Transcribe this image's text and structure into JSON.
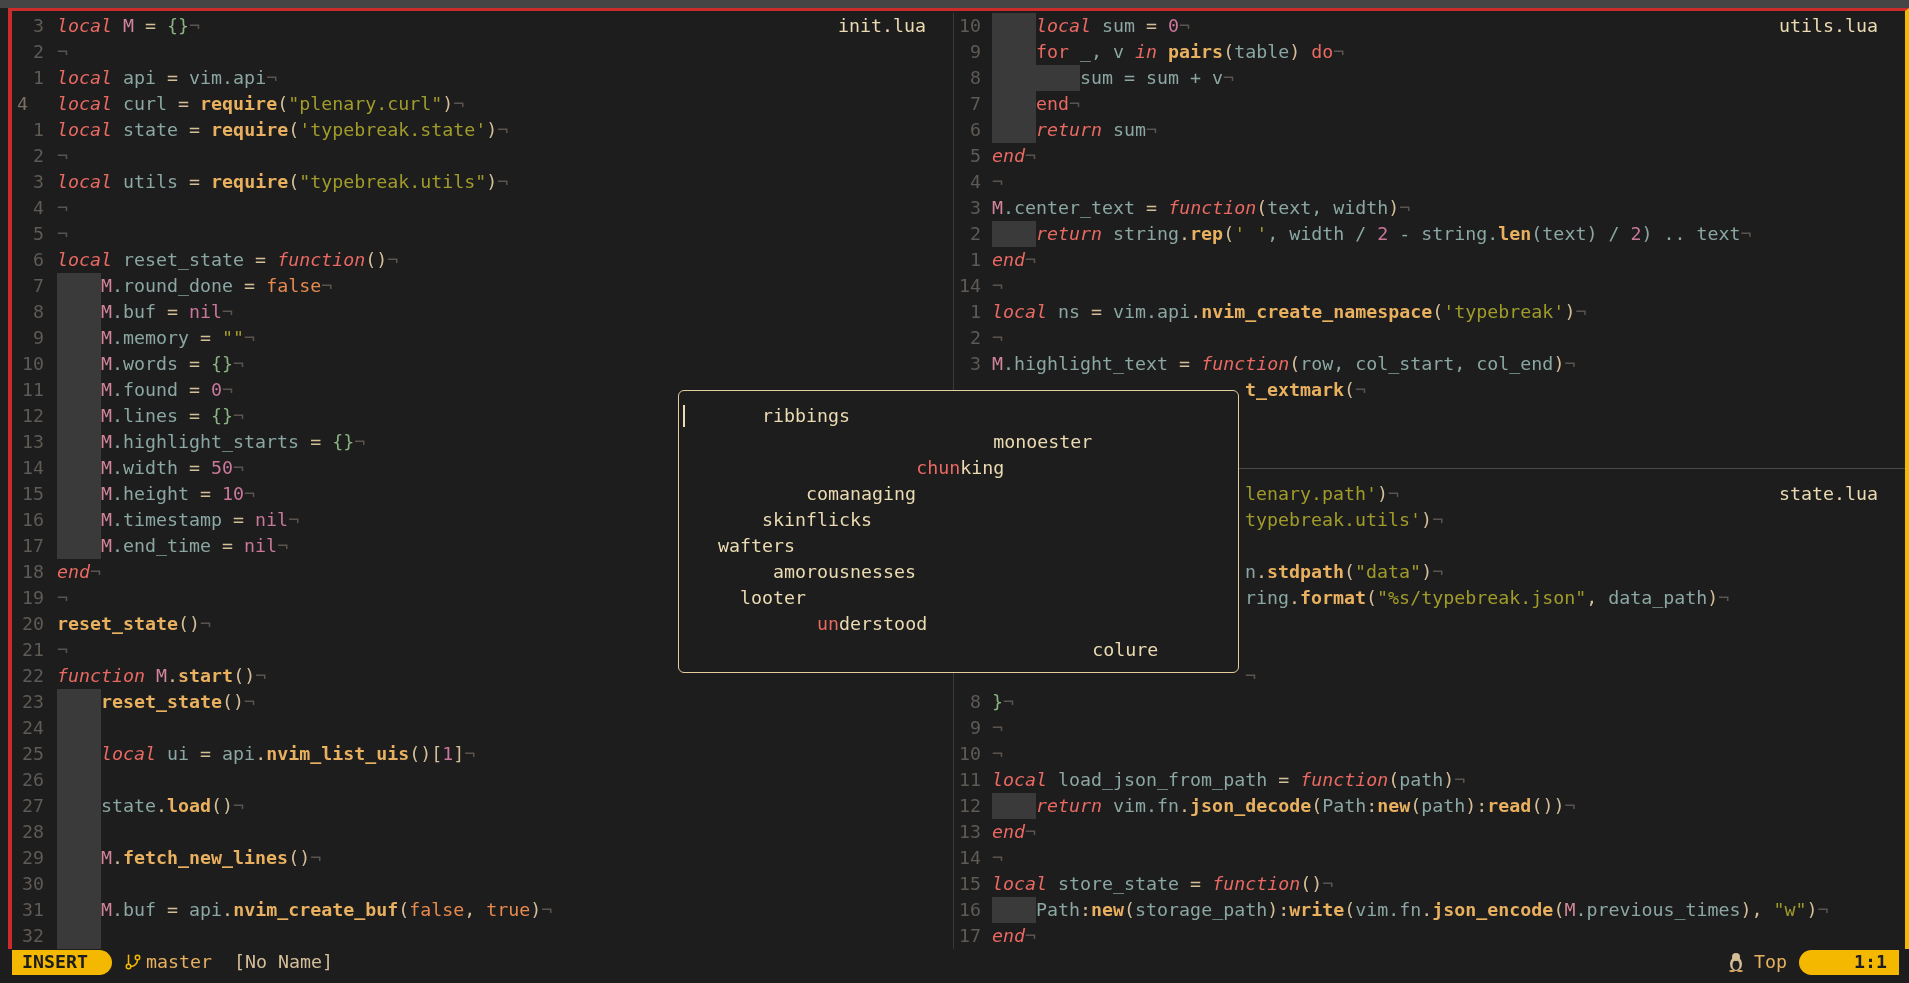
{
  "panes": [
    {
      "title": "init.lua",
      "rows": [
        {
          "kind": "code",
          "number": "3",
          "current": false,
          "tokens": [
            {
              "text": "local",
              "kind": "kw"
            },
            {
              "text": " M",
              "kind": "mod"
            },
            {
              "text": " = ",
              "kind": "op"
            },
            {
              "text": "{}",
              "kind": "tbl"
            },
            {
              "text": "¬",
              "kind": "eol"
            }
          ]
        },
        {
          "kind": "code",
          "number": "2",
          "current": false,
          "tokens": [
            {
              "text": "¬",
              "kind": "eol"
            }
          ]
        },
        {
          "kind": "code",
          "number": "1",
          "current": false,
          "tokens": [
            {
              "text": "local",
              "kind": "kw"
            },
            {
              "text": " api",
              "kind": "id"
            },
            {
              "text": " = ",
              "kind": "op"
            },
            {
              "text": "vim.api",
              "kind": "id"
            },
            {
              "text": "¬",
              "kind": "eol"
            }
          ]
        },
        {
          "kind": "code",
          "number": "4",
          "current": true,
          "tokens": [
            {
              "text": "local",
              "kind": "kw"
            },
            {
              "text": " curl",
              "kind": "id"
            },
            {
              "text": " = ",
              "kind": "op"
            },
            {
              "text": "require",
              "kind": "fn"
            },
            {
              "text": "(",
              "kind": "op"
            },
            {
              "text": "\"plenary.curl\"",
              "kind": "str"
            },
            {
              "text": ")",
              "kind": "op"
            },
            {
              "text": "¬",
              "kind": "eol"
            }
          ]
        },
        {
          "kind": "code",
          "number": "1",
          "current": false,
          "tokens": [
            {
              "text": "local",
              "kind": "kw"
            },
            {
              "text": " state",
              "kind": "id"
            },
            {
              "text": " = ",
              "kind": "op"
            },
            {
              "text": "require",
              "kind": "fn"
            },
            {
              "text": "(",
              "kind": "op"
            },
            {
              "text": "'typebreak.state'",
              "kind": "str"
            },
            {
              "text": ")",
              "kind": "op"
            },
            {
              "text": "¬",
              "kind": "eol"
            }
          ]
        },
        {
          "kind": "code",
          "number": "2",
          "current": false,
          "tokens": [
            {
              "text": "¬",
              "kind": "eol"
            }
          ]
        },
        {
          "kind": "code",
          "number": "3",
          "current": false,
          "tokens": [
            {
              "text": "local",
              "kind": "kw"
            },
            {
              "text": " utils",
              "kind": "id"
            },
            {
              "text": " = ",
              "kind": "op"
            },
            {
              "text": "require",
              "kind": "fn"
            },
            {
              "text": "(",
              "kind": "op"
            },
            {
              "text": "\"typebreak.utils\"",
              "kind": "str"
            },
            {
              "text": ")",
              "kind": "op"
            },
            {
              "text": "¬",
              "kind": "eol"
            }
          ]
        },
        {
          "kind": "code",
          "number": "4",
          "current": false,
          "tokens": [
            {
              "text": "¬",
              "kind": "eol"
            }
          ]
        },
        {
          "kind": "code",
          "number": "5",
          "current": false,
          "tokens": [
            {
              "text": "¬",
              "kind": "eol"
            }
          ]
        },
        {
          "kind": "code",
          "number": "6",
          "current": false,
          "tokens": [
            {
              "text": "local",
              "kind": "kw"
            },
            {
              "text": " reset_state",
              "kind": "id"
            },
            {
              "text": " = ",
              "kind": "op"
            },
            {
              "text": "function",
              "kind": "kw"
            },
            {
              "text": "()",
              "kind": "op"
            },
            {
              "text": "¬",
              "kind": "eol"
            }
          ]
        },
        {
          "kind": "code",
          "number": "7",
          "current": false,
          "indent": [
            {
              "shaded": true
            }
          ],
          "tokens": [
            {
              "text": "M",
              "kind": "mod"
            },
            {
              "text": ".round_done",
              "kind": "id"
            },
            {
              "text": " = ",
              "kind": "op"
            },
            {
              "text": "false",
              "kind": "bool"
            },
            {
              "text": "¬",
              "kind": "eol"
            }
          ]
        },
        {
          "kind": "code",
          "number": "8",
          "current": false,
          "indent": [
            {
              "shaded": true
            }
          ],
          "tokens": [
            {
              "text": "M",
              "kind": "mod"
            },
            {
              "text": ".buf",
              "kind": "id"
            },
            {
              "text": " = ",
              "kind": "op"
            },
            {
              "text": "nil",
              "kind": "num"
            },
            {
              "text": "¬",
              "kind": "eol"
            }
          ]
        },
        {
          "kind": "code",
          "number": "9",
          "current": false,
          "indent": [
            {
              "shaded": true
            }
          ],
          "tokens": [
            {
              "text": "M",
              "kind": "mod"
            },
            {
              "text": ".memory",
              "kind": "id"
            },
            {
              "text": " = ",
              "kind": "op"
            },
            {
              "text": "\"\"",
              "kind": "str"
            },
            {
              "text": "¬",
              "kind": "eol"
            }
          ]
        },
        {
          "kind": "code",
          "number": "10",
          "current": false,
          "indent": [
            {
              "shaded": true
            }
          ],
          "tokens": [
            {
              "text": "M",
              "kind": "mod"
            },
            {
              "text": ".words",
              "kind": "id"
            },
            {
              "text": " = ",
              "kind": "op"
            },
            {
              "text": "{}",
              "kind": "tbl"
            },
            {
              "text": "¬",
              "kind": "eol"
            }
          ]
        },
        {
          "kind": "code",
          "number": "11",
          "current": false,
          "indent": [
            {
              "shaded": true
            }
          ],
          "tokens": [
            {
              "text": "M",
              "kind": "mod"
            },
            {
              "text": ".found",
              "kind": "id"
            },
            {
              "text": " = ",
              "kind": "op"
            },
            {
              "text": "0",
              "kind": "num"
            },
            {
              "text": "¬",
              "kind": "eol"
            }
          ]
        },
        {
          "kind": "code",
          "number": "12",
          "current": false,
          "indent": [
            {
              "shaded": true
            }
          ],
          "tokens": [
            {
              "text": "M",
              "kind": "mod"
            },
            {
              "text": ".lines",
              "kind": "id"
            },
            {
              "text": " = ",
              "kind": "op"
            },
            {
              "text": "{}",
              "kind": "tbl"
            },
            {
              "text": "¬",
              "kind": "eol"
            }
          ]
        },
        {
          "kind": "code",
          "number": "13",
          "current": false,
          "indent": [
            {
              "shaded": true
            }
          ],
          "tokens": [
            {
              "text": "M",
              "kind": "mod"
            },
            {
              "text": ".highlight_starts",
              "kind": "id"
            },
            {
              "text": " = ",
              "kind": "op"
            },
            {
              "text": "{}",
              "kind": "tbl"
            },
            {
              "text": "¬",
              "kind": "eol"
            }
          ]
        },
        {
          "kind": "code",
          "number": "14",
          "current": false,
          "indent": [
            {
              "shaded": true
            }
          ],
          "tokens": [
            {
              "text": "M",
              "kind": "mod"
            },
            {
              "text": ".width",
              "kind": "id"
            },
            {
              "text": " = ",
              "kind": "op"
            },
            {
              "text": "50",
              "kind": "num"
            },
            {
              "text": "¬",
              "kind": "eol"
            }
          ]
        },
        {
          "kind": "code",
          "number": "15",
          "current": false,
          "indent": [
            {
              "shaded": true
            }
          ],
          "tokens": [
            {
              "text": "M",
              "kind": "mod"
            },
            {
              "text": ".height",
              "kind": "id"
            },
            {
              "text": " = ",
              "kind": "op"
            },
            {
              "text": "10",
              "kind": "num"
            },
            {
              "text": "¬",
              "kind": "eol"
            }
          ]
        },
        {
          "kind": "code",
          "number": "16",
          "current": false,
          "indent": [
            {
              "shaded": true
            }
          ],
          "tokens": [
            {
              "text": "M",
              "kind": "mod"
            },
            {
              "text": ".timestamp",
              "kind": "id"
            },
            {
              "text": " = ",
              "kind": "op"
            },
            {
              "text": "nil",
              "kind": "num"
            },
            {
              "text": "¬",
              "kind": "eol"
            }
          ]
        },
        {
          "kind": "code",
          "number": "17",
          "current": false,
          "indent": [
            {
              "shaded": true
            }
          ],
          "tokens": [
            {
              "text": "M",
              "kind": "mod"
            },
            {
              "text": ".end_time",
              "kind": "id"
            },
            {
              "text": " = ",
              "kind": "op"
            },
            {
              "text": "nil",
              "kind": "num"
            },
            {
              "text": "¬",
              "kind": "eol"
            }
          ]
        },
        {
          "kind": "code",
          "number": "18",
          "current": false,
          "tokens": [
            {
              "text": "end",
              "kind": "kw"
            },
            {
              "text": "¬",
              "kind": "eol"
            }
          ]
        },
        {
          "kind": "code",
          "number": "19",
          "current": false,
          "tokens": [
            {
              "text": "¬",
              "kind": "eol"
            }
          ]
        },
        {
          "kind": "code",
          "number": "20",
          "current": false,
          "tokens": [
            {
              "text": "reset_state",
              "kind": "fn"
            },
            {
              "text": "()",
              "kind": "op"
            },
            {
              "text": "¬",
              "kind": "eol"
            }
          ]
        },
        {
          "kind": "code",
          "number": "21",
          "current": false,
          "tokens": [
            {
              "text": "¬",
              "kind": "eol"
            }
          ]
        },
        {
          "kind": "code",
          "number": "22",
          "current": false,
          "tokens": [
            {
              "text": "function",
              "kind": "kw"
            },
            {
              "text": " M",
              "kind": "mod"
            },
            {
              "text": ".",
              "kind": "op"
            },
            {
              "text": "start",
              "kind": "fn"
            },
            {
              "text": "()",
              "kind": "op"
            },
            {
              "text": "¬",
              "kind": "eol"
            }
          ]
        },
        {
          "kind": "code",
          "number": "23",
          "current": false,
          "indent": [
            {
              "shaded": true
            }
          ],
          "tokens": [
            {
              "text": "reset_state",
              "kind": "fn"
            },
            {
              "text": "()",
              "kind": "op"
            },
            {
              "text": "¬",
              "kind": "eol"
            }
          ]
        },
        {
          "kind": "code",
          "number": "24",
          "current": false,
          "indent": [
            {
              "shaded": true
            }
          ]
        },
        {
          "kind": "code",
          "number": "25",
          "current": false,
          "indent": [
            {
              "shaded": true
            }
          ],
          "tokens": [
            {
              "text": "local",
              "kind": "kw"
            },
            {
              "text": " ui",
              "kind": "id"
            },
            {
              "text": " = ",
              "kind": "op"
            },
            {
              "text": "api",
              "kind": "id"
            },
            {
              "text": ".",
              "kind": "op"
            },
            {
              "text": "nvim_list_uis",
              "kind": "fn"
            },
            {
              "text": "()[",
              "kind": "op"
            },
            {
              "text": "1",
              "kind": "num"
            },
            {
              "text": "]",
              "kind": "op"
            },
            {
              "text": "¬",
              "kind": "eol"
            }
          ]
        },
        {
          "kind": "code",
          "number": "26",
          "current": false,
          "indent": [
            {
              "shaded": true
            }
          ]
        },
        {
          "kind": "code",
          "number": "27",
          "current": false,
          "indent": [
            {
              "shaded": true
            }
          ],
          "tokens": [
            {
              "text": "state",
              "kind": "id"
            },
            {
              "text": ".",
              "kind": "op"
            },
            {
              "text": "load",
              "kind": "fn"
            },
            {
              "text": "()",
              "kind": "op"
            },
            {
              "text": "¬",
              "kind": "eol"
            }
          ]
        },
        {
          "kind": "code",
          "number": "28",
          "current": false,
          "indent": [
            {
              "shaded": true
            }
          ]
        },
        {
          "kind": "code",
          "number": "29",
          "current": false,
          "indent": [
            {
              "shaded": true
            }
          ],
          "tokens": [
            {
              "text": "M",
              "kind": "mod"
            },
            {
              "text": ".",
              "kind": "op"
            },
            {
              "text": "fetch_new_lines",
              "kind": "fn"
            },
            {
              "text": "()",
              "kind": "op"
            },
            {
              "text": "¬",
              "kind": "eol"
            }
          ]
        },
        {
          "kind": "code",
          "number": "30",
          "current": false,
          "indent": [
            {
              "shaded": true
            }
          ]
        },
        {
          "kind": "code",
          "number": "31",
          "current": false,
          "indent": [
            {
              "shaded": true
            }
          ],
          "tokens": [
            {
              "text": "M",
              "kind": "mod"
            },
            {
              "text": ".buf",
              "kind": "id"
            },
            {
              "text": " = ",
              "kind": "op"
            },
            {
              "text": "api",
              "kind": "id"
            },
            {
              "text": ".",
              "kind": "op"
            },
            {
              "text": "nvim_create_buf",
              "kind": "fn"
            },
            {
              "text": "(",
              "kind": "op"
            },
            {
              "text": "false",
              "kind": "bool"
            },
            {
              "text": ", ",
              "kind": "op"
            },
            {
              "text": "true",
              "kind": "bool"
            },
            {
              "text": ")",
              "kind": "op"
            },
            {
              "text": "¬",
              "kind": "eol"
            }
          ]
        },
        {
          "kind": "code",
          "number": "32",
          "current": false,
          "indent": [
            {
              "shaded": true
            }
          ]
        }
      ]
    },
    {
      "title": "utils.lua",
      "rows": [
        {
          "kind": "code",
          "number": "10",
          "current": false,
          "indent": [
            {
              "shaded": true
            }
          ],
          "tokens": [
            {
              "text": "local",
              "kind": "kw"
            },
            {
              "text": " sum",
              "kind": "id"
            },
            {
              "text": " = ",
              "kind": "op"
            },
            {
              "text": "0",
              "kind": "num"
            },
            {
              "text": "¬",
              "kind": "eol"
            }
          ]
        },
        {
          "kind": "code",
          "number": "9",
          "current": false,
          "indent": [
            {
              "shaded": true
            }
          ],
          "tokens": [
            {
              "text": "for",
              "kind": "ctl"
            },
            {
              "text": " _, v ",
              "kind": "id"
            },
            {
              "text": "in",
              "kind": "kw"
            },
            {
              "text": " pairs",
              "kind": "fn"
            },
            {
              "text": "(",
              "kind": "op"
            },
            {
              "text": "table",
              "kind": "id"
            },
            {
              "text": ") ",
              "kind": "op"
            },
            {
              "text": "do",
              "kind": "ctl"
            },
            {
              "text": "¬",
              "kind": "eol"
            }
          ]
        },
        {
          "kind": "code",
          "number": "8",
          "current": false,
          "indent": [
            {
              "shaded": true
            },
            {
              "shaded": true
            }
          ],
          "tokens": [
            {
              "text": "sum = sum + v",
              "kind": "id"
            },
            {
              "text": "¬",
              "kind": "eol"
            }
          ]
        },
        {
          "kind": "code",
          "number": "7",
          "current": false,
          "indent": [
            {
              "shaded": true
            }
          ],
          "tokens": [
            {
              "text": "end",
              "kind": "ctl"
            },
            {
              "text": "¬",
              "kind": "eol"
            }
          ]
        },
        {
          "kind": "code",
          "number": "6",
          "current": false,
          "indent": [
            {
              "shaded": true
            }
          ],
          "tokens": [
            {
              "text": "return",
              "kind": "kw"
            },
            {
              "text": " sum",
              "kind": "id"
            },
            {
              "text": "¬",
              "kind": "eol"
            }
          ]
        },
        {
          "kind": "code",
          "number": "5",
          "current": false,
          "tokens": [
            {
              "text": "end",
              "kind": "kw"
            },
            {
              "text": "¬",
              "kind": "eol"
            }
          ]
        },
        {
          "kind": "code",
          "number": "4",
          "current": false,
          "tokens": [
            {
              "text": "¬",
              "kind": "eol"
            }
          ]
        },
        {
          "kind": "code",
          "number": "3",
          "current": false,
          "tokens": [
            {
              "text": "M",
              "kind": "mod"
            },
            {
              "text": ".center_text",
              "kind": "id"
            },
            {
              "text": " = ",
              "kind": "op"
            },
            {
              "text": "function",
              "kind": "kw"
            },
            {
              "text": "(",
              "kind": "op"
            },
            {
              "text": "text, width",
              "kind": "id"
            },
            {
              "text": ")",
              "kind": "op"
            },
            {
              "text": "¬",
              "kind": "eol"
            }
          ]
        },
        {
          "kind": "code",
          "number": "2",
          "current": false,
          "indent": [
            {
              "shaded": true
            }
          ],
          "tokens": [
            {
              "text": "return",
              "kind": "kw"
            },
            {
              "text": " string",
              "kind": "id"
            },
            {
              "text": ".",
              "kind": "op"
            },
            {
              "text": "rep",
              "kind": "fn"
            },
            {
              "text": "(",
              "kind": "op"
            },
            {
              "text": "' '",
              "kind": "str"
            },
            {
              "text": ", width / ",
              "kind": "id"
            },
            {
              "text": "2",
              "kind": "num"
            },
            {
              "text": " - string.",
              "kind": "id"
            },
            {
              "text": "len",
              "kind": "fn"
            },
            {
              "text": "(text) / ",
              "kind": "id"
            },
            {
              "text": "2",
              "kind": "num"
            },
            {
              "text": ") .. text",
              "kind": "id"
            },
            {
              "text": "¬",
              "kind": "eol"
            }
          ]
        },
        {
          "kind": "code",
          "number": "1",
          "current": false,
          "tokens": [
            {
              "text": "end",
              "kind": "kw"
            },
            {
              "text": "¬",
              "kind": "eol"
            }
          ]
        },
        {
          "kind": "code",
          "number": "14",
          "current": false,
          "tokens": [
            {
              "text": "¬",
              "kind": "eol"
            }
          ]
        },
        {
          "kind": "code",
          "number": "1",
          "current": false,
          "tokens": [
            {
              "text": "local",
              "kind": "kw"
            },
            {
              "text": " ns",
              "kind": "id"
            },
            {
              "text": " = ",
              "kind": "op"
            },
            {
              "text": "vim.api",
              "kind": "id"
            },
            {
              "text": ".",
              "kind": "op"
            },
            {
              "text": "nvim_create_namespace",
              "kind": "fn"
            },
            {
              "text": "(",
              "kind": "op"
            },
            {
              "text": "'typebreak'",
              "kind": "str"
            },
            {
              "text": ")",
              "kind": "op"
            },
            {
              "text": "¬",
              "kind": "eol"
            }
          ]
        },
        {
          "kind": "code",
          "number": "2",
          "current": false,
          "tokens": [
            {
              "text": "¬",
              "kind": "eol"
            }
          ]
        },
        {
          "kind": "code",
          "number": "3",
          "current": false,
          "tokens": [
            {
              "text": "M",
              "kind": "mod"
            },
            {
              "text": ".highlight_text",
              "kind": "id"
            },
            {
              "text": " = ",
              "kind": "op"
            },
            {
              "text": "function",
              "kind": "kw"
            },
            {
              "text": "(",
              "kind": "op"
            },
            {
              "text": "row, col_start, col_end",
              "kind": "id"
            },
            {
              "text": ")",
              "kind": "op"
            },
            {
              "text": "¬",
              "kind": "eol"
            }
          ]
        },
        {
          "kind": "clipped",
          "tokens": [
            {
              "text": "t_extmark",
              "kind": "fn"
            },
            {
              "text": "(",
              "kind": "op"
            },
            {
              "text": "¬",
              "kind": "eol"
            }
          ]
        },
        {
          "kind": "covered"
        },
        {
          "kind": "covered"
        },
        {
          "kind": "rule"
        }
      ]
    },
    {
      "title": "state.lua",
      "rows": [
        {
          "kind": "clipped",
          "tokens": [
            {
              "text": "lenary.path'",
              "kind": "str"
            },
            {
              "text": ")",
              "kind": "op"
            },
            {
              "text": "¬",
              "kind": "eol"
            }
          ]
        },
        {
          "kind": "clipped",
          "tokens": [
            {
              "text": "typebreak.utils'",
              "kind": "str"
            },
            {
              "text": ")",
              "kind": "op"
            },
            {
              "text": "¬",
              "kind": "eol"
            }
          ]
        },
        {
          "kind": "covered"
        },
        {
          "kind": "clipped",
          "tokens": [
            {
              "text": "n",
              "kind": "id"
            },
            {
              "text": ".",
              "kind": "op"
            },
            {
              "text": "stdpath",
              "kind": "fn"
            },
            {
              "text": "(",
              "kind": "op"
            },
            {
              "text": "\"data\"",
              "kind": "str"
            },
            {
              "text": ")",
              "kind": "op"
            },
            {
              "text": "¬",
              "kind": "eol"
            }
          ]
        },
        {
          "kind": "clipped",
          "tokens": [
            {
              "text": "ring",
              "kind": "id"
            },
            {
              "text": ".",
              "kind": "op"
            },
            {
              "text": "format",
              "kind": "fn"
            },
            {
              "text": "(",
              "kind": "op"
            },
            {
              "text": "\"%s/typebreak.json\"",
              "kind": "str"
            },
            {
              "text": ", ",
              "kind": "op"
            },
            {
              "text": "data_path",
              "kind": "id"
            },
            {
              "text": ")",
              "kind": "op"
            },
            {
              "text": "¬",
              "kind": "eol"
            }
          ]
        },
        {
          "kind": "covered"
        },
        {
          "kind": "covered"
        },
        {
          "kind": "clipped",
          "tokens": [
            {
              "text": "¬",
              "kind": "eol"
            }
          ]
        },
        {
          "kind": "code",
          "number": "8",
          "current": false,
          "tokens": [
            {
              "text": "}",
              "kind": "tbl"
            },
            {
              "text": "¬",
              "kind": "eol"
            }
          ]
        },
        {
          "kind": "code",
          "number": "9",
          "current": false,
          "tokens": [
            {
              "text": "¬",
              "kind": "eol"
            }
          ]
        },
        {
          "kind": "code",
          "number": "10",
          "current": false,
          "tokens": [
            {
              "text": "¬",
              "kind": "eol"
            }
          ]
        },
        {
          "kind": "code",
          "number": "11",
          "current": false,
          "tokens": [
            {
              "text": "local",
              "kind": "kw"
            },
            {
              "text": " load_json_from_path",
              "kind": "id"
            },
            {
              "text": " = ",
              "kind": "op"
            },
            {
              "text": "function",
              "kind": "kw"
            },
            {
              "text": "(",
              "kind": "op"
            },
            {
              "text": "path",
              "kind": "id"
            },
            {
              "text": ")",
              "kind": "op"
            },
            {
              "text": "¬",
              "kind": "eol"
            }
          ]
        },
        {
          "kind": "code",
          "number": "12",
          "current": false,
          "indent": [
            {
              "shaded": true
            }
          ],
          "tokens": [
            {
              "text": "return",
              "kind": "kw"
            },
            {
              "text": " vim.fn",
              "kind": "id"
            },
            {
              "text": ".",
              "kind": "op"
            },
            {
              "text": "json_decode",
              "kind": "fn"
            },
            {
              "text": "(",
              "kind": "op"
            },
            {
              "text": "Path",
              "kind": "id"
            },
            {
              "text": ":",
              "kind": "op"
            },
            {
              "text": "new",
              "kind": "fn"
            },
            {
              "text": "(",
              "kind": "op"
            },
            {
              "text": "path",
              "kind": "id"
            },
            {
              "text": "):",
              "kind": "op"
            },
            {
              "text": "read",
              "kind": "fn"
            },
            {
              "text": "())",
              "kind": "op"
            },
            {
              "text": "¬",
              "kind": "eol"
            }
          ]
        },
        {
          "kind": "code",
          "number": "13",
          "current": false,
          "tokens": [
            {
              "text": "end",
              "kind": "kw"
            },
            {
              "text": "¬",
              "kind": "eol"
            }
          ]
        },
        {
          "kind": "code",
          "number": "14",
          "current": false,
          "tokens": [
            {
              "text": "¬",
              "kind": "eol"
            }
          ]
        },
        {
          "kind": "code",
          "number": "15",
          "current": false,
          "tokens": [
            {
              "text": "local",
              "kind": "kw"
            },
            {
              "text": " store_state",
              "kind": "id"
            },
            {
              "text": " = ",
              "kind": "op"
            },
            {
              "text": "function",
              "kind": "kw"
            },
            {
              "text": "()",
              "kind": "op"
            },
            {
              "text": "¬",
              "kind": "eol"
            }
          ]
        },
        {
          "kind": "code",
          "number": "16",
          "current": false,
          "indent": [
            {
              "shaded": true
            }
          ],
          "tokens": [
            {
              "text": "Path",
              "kind": "id"
            },
            {
              "text": ":",
              "kind": "op"
            },
            {
              "text": "new",
              "kind": "fn"
            },
            {
              "text": "(",
              "kind": "op"
            },
            {
              "text": "storage_path",
              "kind": "id"
            },
            {
              "text": "):",
              "kind": "op"
            },
            {
              "text": "write",
              "kind": "fn"
            },
            {
              "text": "(",
              "kind": "op"
            },
            {
              "text": "vim.fn",
              "kind": "id"
            },
            {
              "text": ".",
              "kind": "op"
            },
            {
              "text": "json_encode",
              "kind": "fn"
            },
            {
              "text": "(",
              "kind": "op"
            },
            {
              "text": "M",
              "kind": "mod"
            },
            {
              "text": ".previous_times",
              "kind": "id"
            },
            {
              "text": "), ",
              "kind": "op"
            },
            {
              "text": "\"w\"",
              "kind": "str"
            },
            {
              "text": ")",
              "kind": "op"
            },
            {
              "text": "¬",
              "kind": "eol"
            }
          ]
        },
        {
          "kind": "code",
          "number": "17",
          "current": false,
          "tokens": [
            {
              "text": "end",
              "kind": "kw"
            },
            {
              "text": "¬",
              "kind": "eol"
            }
          ]
        }
      ]
    }
  ],
  "popup": {
    "words": [
      {
        "text": "       ribbings"
      },
      {
        "text": "                            monoester"
      },
      {
        "typed": "                     chun",
        "rest": "king"
      },
      {
        "text": "           comanaging"
      },
      {
        "text": "       skinflicks"
      },
      {
        "text": "   wafters"
      },
      {
        "text": "        amorousnesses"
      },
      {
        "text": "     looter"
      },
      {
        "typed": "            un",
        "rest": "derstood"
      },
      {
        "text": "                                     colure"
      }
    ]
  },
  "status_bar": {
    "mode": "INSERT",
    "branch": "master",
    "file": "[No Name]",
    "scroll": "Top",
    "position": "1:1"
  }
}
